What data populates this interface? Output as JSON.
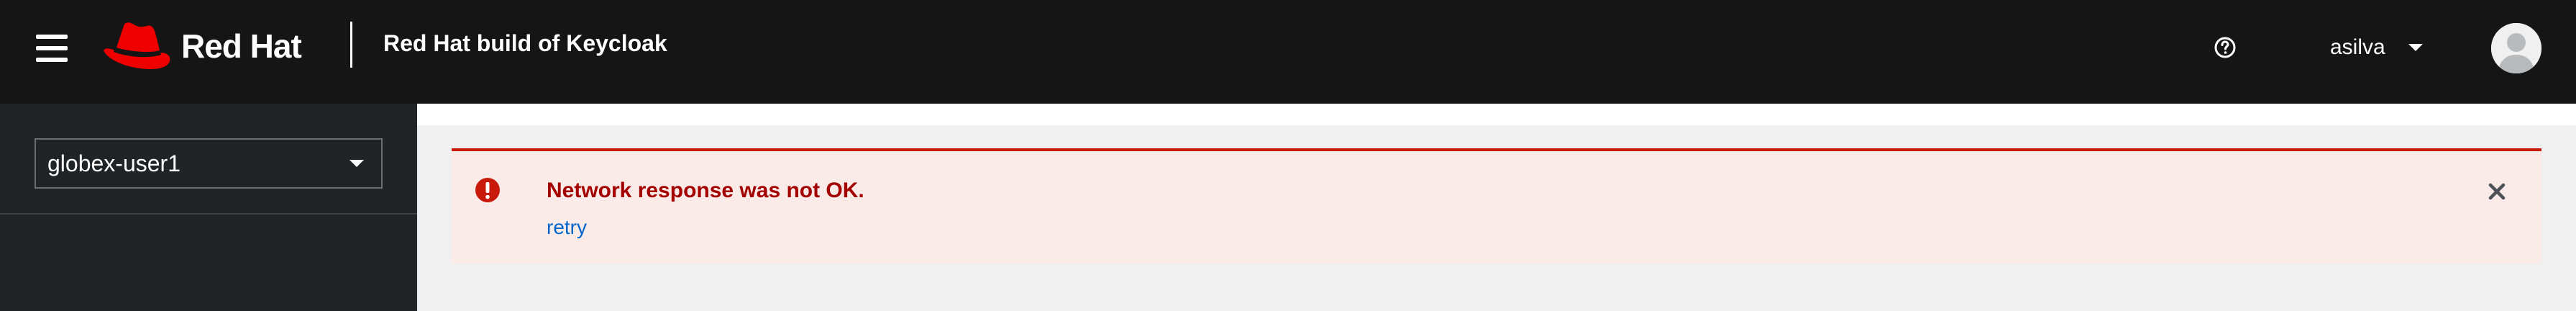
{
  "masthead": {
    "brand": "Red Hat",
    "product": "Red Hat build of Keycloak",
    "menu_icon": "hamburger-menu-icon",
    "help_icon": "help-circle-icon",
    "user": {
      "name": "asilva",
      "caret_icon": "caret-down-icon",
      "avatar_icon": "avatar-icon"
    }
  },
  "sidebar": {
    "realm_selector": {
      "value": "globex-user1",
      "caret_icon": "caret-down-icon"
    }
  },
  "alert": {
    "variant": "danger",
    "icon": "exclamation-circle-icon",
    "title": "Network response was not OK.",
    "action_link": "retry",
    "close_icon": "close-icon"
  },
  "colors": {
    "masthead_bg": "#151515",
    "sidebar_bg": "#212427",
    "brand_red": "#ee0000",
    "alert_bg": "#faeae8",
    "alert_border": "#c9190b",
    "alert_title": "#a30000",
    "link": "#0066cc",
    "page_bg": "#f0f0f0"
  }
}
